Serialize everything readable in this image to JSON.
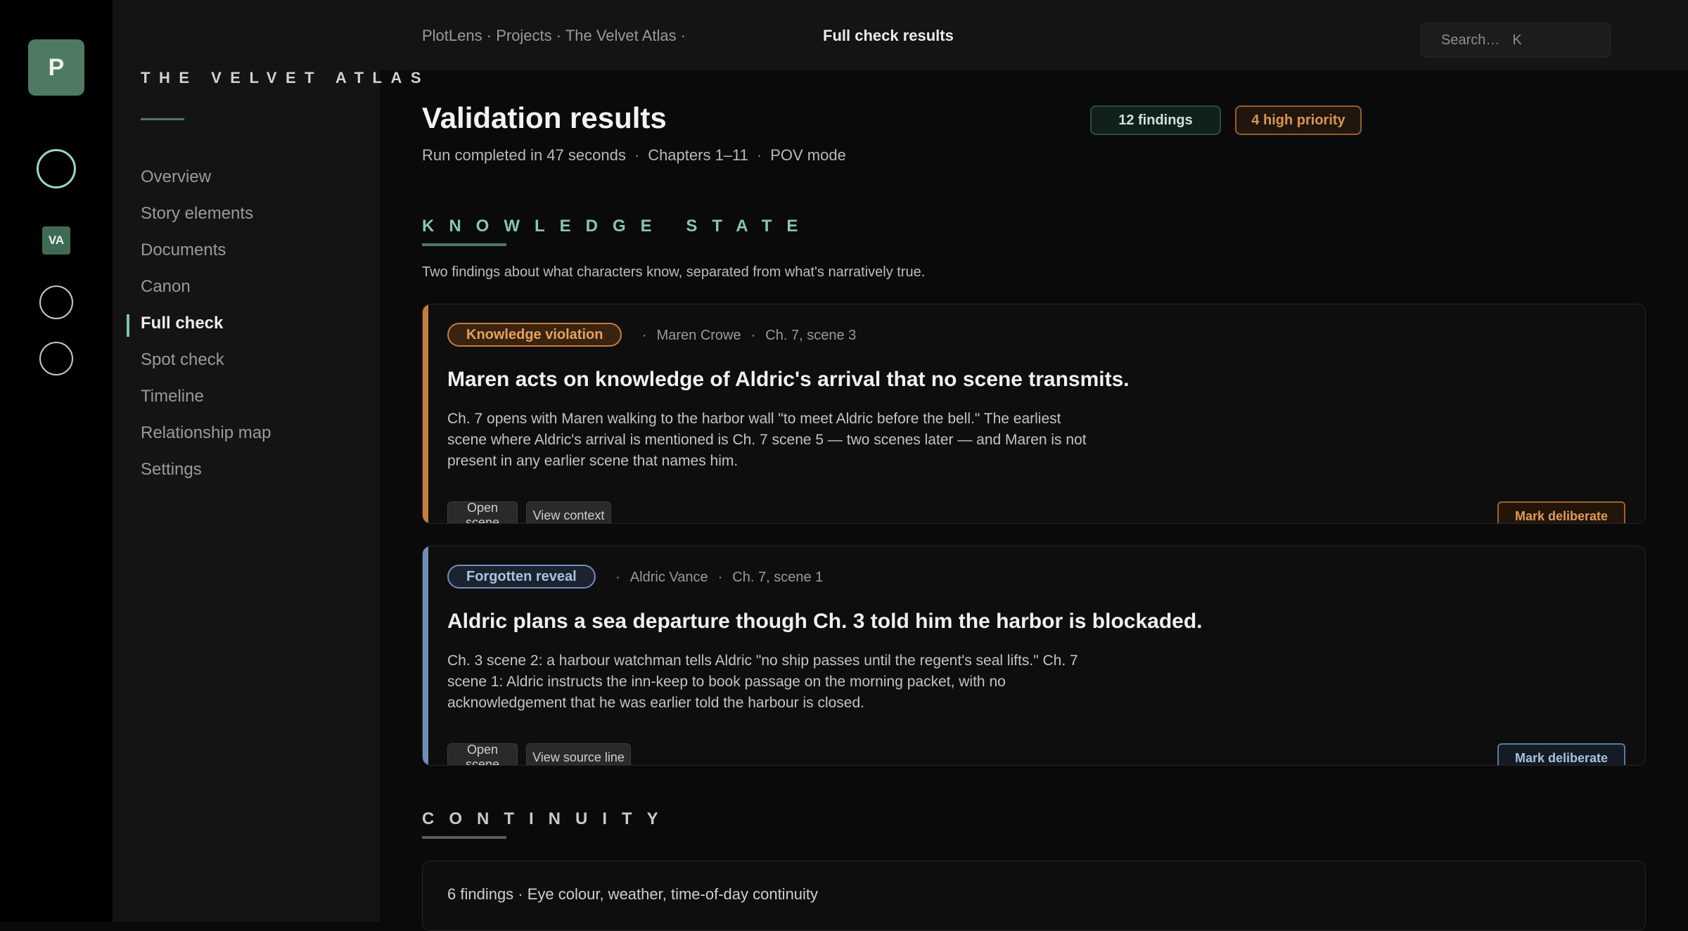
{
  "rail": {
    "logo_letter": "P",
    "project_badge": "VA"
  },
  "sidebar": {
    "project_name": "THE VELVET ATLAS",
    "items": [
      {
        "label": "Overview"
      },
      {
        "label": "Story elements"
      },
      {
        "label": "Documents"
      },
      {
        "label": "Canon"
      },
      {
        "label": "Full check",
        "active": true
      },
      {
        "label": "Spot check"
      },
      {
        "label": "Timeline"
      },
      {
        "label": "Relationship map"
      },
      {
        "label": "Settings"
      }
    ]
  },
  "topbar": {
    "breadcrumbs": [
      "PlotLens",
      "Projects",
      "The Velvet Atlas"
    ],
    "crumb_sep": " · ",
    "trailing_sep": " ·",
    "page_tab": "Full check results",
    "search_placeholder": "Search…",
    "search_shortcut": "K"
  },
  "header": {
    "title": "Validation results",
    "meta": [
      "Run completed in 47 seconds",
      "Chapters 1–11",
      "POV mode"
    ],
    "meta_sep": "·",
    "findings_badge": "12 findings",
    "priority_badge": "4 high priority"
  },
  "colors": {
    "accent_green": "#86c7ad",
    "knowledge_orange": "#c47d3c",
    "reveal_blue": "#6f8fb8"
  },
  "sections": {
    "knowledge": {
      "heading": "KNOWLEDGE STATE",
      "description": "Two findings about what characters know, separated from what's narratively true."
    },
    "continuity": {
      "heading": "CONTINUITY",
      "summary": "6 findings · Eye colour, weather, time-of-day continuity"
    }
  },
  "findings": [
    {
      "tag": "Knowledge violation",
      "character": "Maren Crowe",
      "location": "Ch. 7, scene 3",
      "title": "Maren acts on knowledge of Aldric's arrival that no scene transmits.",
      "body": "Ch. 7 opens with Maren walking to the harbor wall \"to meet Aldric before the bell.\" The earliest scene where Aldric's arrival is mentioned is Ch. 7 scene 5 — two scenes later — and Maren is not present in any earlier scene that names him.",
      "actions": [
        "Open scene",
        "View context"
      ],
      "mark_label": "Mark deliberate"
    },
    {
      "tag": "Forgotten reveal",
      "character": "Aldric Vance",
      "location": "Ch. 7, scene 1",
      "title": "Aldric plans a sea departure though Ch. 3 told him the harbor is blockaded.",
      "body": "Ch. 3 scene 2: a harbour watchman tells Aldric \"no ship passes until the regent's seal lifts.\" Ch. 7 scene 1: Aldric instructs the inn-keep to book passage on the morning packet, with no acknowledgement that he was earlier told the harbour is closed.",
      "actions": [
        "Open scene",
        "View source line"
      ],
      "mark_label": "Mark deliberate"
    }
  ]
}
